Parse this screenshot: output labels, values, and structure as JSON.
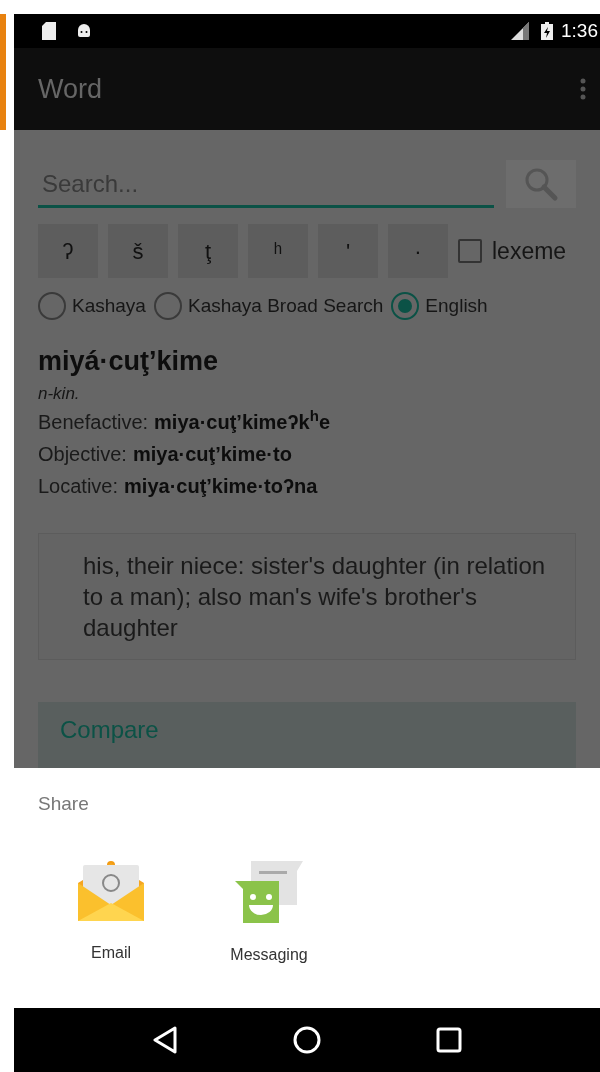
{
  "status_bar": {
    "time": "1:36"
  },
  "app_bar": {
    "title": "Word"
  },
  "search": {
    "placeholder": "Search..."
  },
  "char_keys": [
    "ʔ",
    "š",
    "ţ",
    "ʰ",
    "'",
    "·"
  ],
  "lexeme": {
    "label": "lexeme",
    "checked": false
  },
  "modes": [
    {
      "label": "Kashaya",
      "selected": false
    },
    {
      "label": "Kashaya Broad Search",
      "selected": false
    },
    {
      "label": "English",
      "selected": true
    }
  ],
  "entry": {
    "headword": "miyá·cuţ’kime",
    "pos": "n-kin.",
    "forms": [
      {
        "label": "Benefactive:",
        "value": "miya·cuţ’kimeʔk$^{h}$e"
      },
      {
        "label": "Objective:",
        "value": "miya·cuţ’kime·to"
      },
      {
        "label": "Locative:",
        "value": "miya·cuţ’kime·toʔna"
      }
    ],
    "definition": "his, their niece: sister's daughter (in relation to a man); also man's wife's brother's daughter",
    "compare": {
      "title": "Compare"
    }
  },
  "share_sheet": {
    "title": "Share",
    "targets": [
      {
        "kind": "email",
        "label": "Email"
      },
      {
        "kind": "messaging",
        "label": "Messaging"
      }
    ]
  }
}
